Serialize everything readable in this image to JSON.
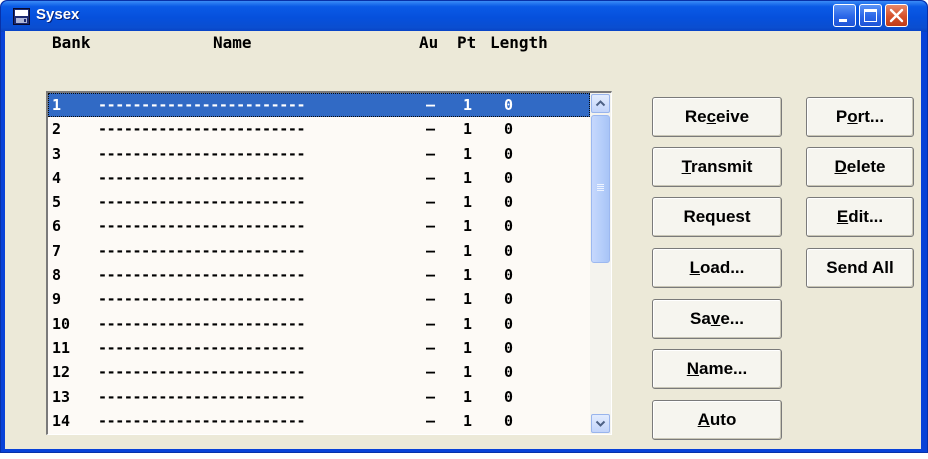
{
  "window": {
    "title": "Sysex",
    "colors": {
      "titlebar": "#0a52dc",
      "client": "#ece9d8",
      "selection": "#316ac5",
      "close": "#d5502a"
    }
  },
  "title_buttons": {
    "minimize_icon": "minimize-icon",
    "maximize_icon": "maximize-icon",
    "close_icon": "close-icon"
  },
  "columns": {
    "bank": "Bank",
    "name": "Name",
    "au": "Au",
    "pt": "Pt",
    "length": "Length"
  },
  "rows": [
    {
      "bank": "1",
      "name": "------------------------",
      "au": "–",
      "pt": "1",
      "length": "0"
    },
    {
      "bank": "2",
      "name": "------------------------",
      "au": "–",
      "pt": "1",
      "length": "0"
    },
    {
      "bank": "3",
      "name": "------------------------",
      "au": "–",
      "pt": "1",
      "length": "0"
    },
    {
      "bank": "4",
      "name": "------------------------",
      "au": "–",
      "pt": "1",
      "length": "0"
    },
    {
      "bank": "5",
      "name": "------------------------",
      "au": "–",
      "pt": "1",
      "length": "0"
    },
    {
      "bank": "6",
      "name": "------------------------",
      "au": "–",
      "pt": "1",
      "length": "0"
    },
    {
      "bank": "7",
      "name": "------------------------",
      "au": "–",
      "pt": "1",
      "length": "0"
    },
    {
      "bank": "8",
      "name": "------------------------",
      "au": "–",
      "pt": "1",
      "length": "0"
    },
    {
      "bank": "9",
      "name": "------------------------",
      "au": "–",
      "pt": "1",
      "length": "0"
    },
    {
      "bank": "10",
      "name": "------------------------",
      "au": "–",
      "pt": "1",
      "length": "0"
    },
    {
      "bank": "11",
      "name": "------------------------",
      "au": "–",
      "pt": "1",
      "length": "0"
    },
    {
      "bank": "12",
      "name": "------------------------",
      "au": "–",
      "pt": "1",
      "length": "0"
    },
    {
      "bank": "13",
      "name": "------------------------",
      "au": "–",
      "pt": "1",
      "length": "0"
    },
    {
      "bank": "14",
      "name": "------------------------",
      "au": "–",
      "pt": "1",
      "length": "0"
    }
  ],
  "selected_row": "1",
  "buttons": {
    "receive": {
      "pre": "Re",
      "key": "c",
      "post": "eive"
    },
    "transmit": {
      "pre": "",
      "key": "T",
      "post": "ransmit"
    },
    "request": {
      "pre": "Request",
      "key": "",
      "post": ""
    },
    "load": {
      "pre": "",
      "key": "L",
      "post": "oad..."
    },
    "save": {
      "pre": "Sa",
      "key": "v",
      "post": "e..."
    },
    "name": {
      "pre": "",
      "key": "N",
      "post": "ame..."
    },
    "auto": {
      "pre": "",
      "key": "A",
      "post": "uto"
    },
    "port": {
      "pre": "P",
      "key": "o",
      "post": "rt..."
    },
    "delete": {
      "pre": "",
      "key": "D",
      "post": "elete"
    },
    "edit": {
      "pre": "",
      "key": "E",
      "post": "dit..."
    },
    "send_all": {
      "pre": "Send All",
      "key": "",
      "post": ""
    }
  }
}
